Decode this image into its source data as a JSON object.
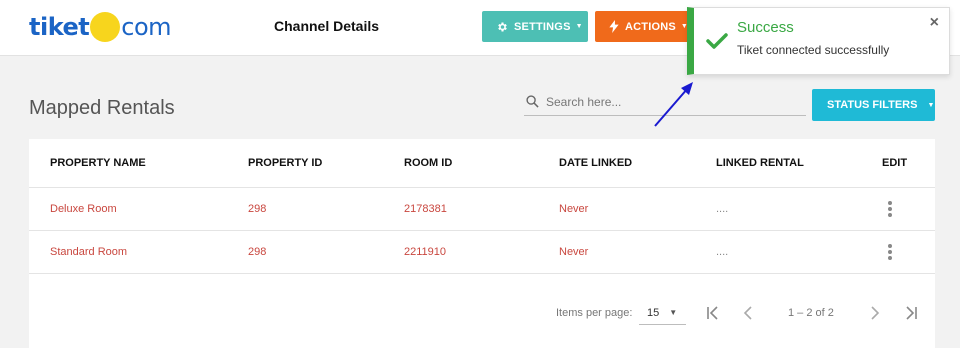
{
  "header": {
    "logo_text_left": "tiket",
    "logo_text_right": "com",
    "page_title": "Channel Details",
    "settings_label": "SETTINGS",
    "actions_label": "ACTIONS"
  },
  "main": {
    "section_title": "Mapped Rentals",
    "search_placeholder": "Search here...",
    "status_filters_label": "STATUS FILTERS"
  },
  "table": {
    "columns": [
      "PROPERTY NAME",
      "PROPERTY ID",
      "ROOM ID",
      "DATE LINKED",
      "LINKED RENTAL",
      "EDIT"
    ],
    "rows": [
      {
        "property_name": "Deluxe Room",
        "property_id": "298",
        "room_id": "2178381",
        "date_linked": "Never",
        "linked_rental": "...."
      },
      {
        "property_name": "Standard Room",
        "property_id": "298",
        "room_id": "2211910",
        "date_linked": "Never",
        "linked_rental": "...."
      }
    ]
  },
  "pagination": {
    "items_per_page_label": "Items per page:",
    "page_size": "15",
    "range_text": "1 – 2 of 2"
  },
  "toast": {
    "title": "Success",
    "message": "Tiket connected successfully",
    "close_glyph": "×"
  },
  "colors": {
    "brand_blue": "#1b64c5",
    "brand_yellow": "#f7d51d",
    "settings_teal": "#4dbfb4",
    "actions_orange": "#f06a1b",
    "status_cyan": "#1fbad6",
    "success_green": "#3aa844",
    "row_text_red": "#c9473f",
    "annotation_arrow_blue": "#1a1ad0"
  },
  "icons": {
    "settings": "gear-icon",
    "actions": "bolt-icon",
    "search": "search-icon",
    "toast": "check-icon",
    "edit": "kebab-icon"
  }
}
